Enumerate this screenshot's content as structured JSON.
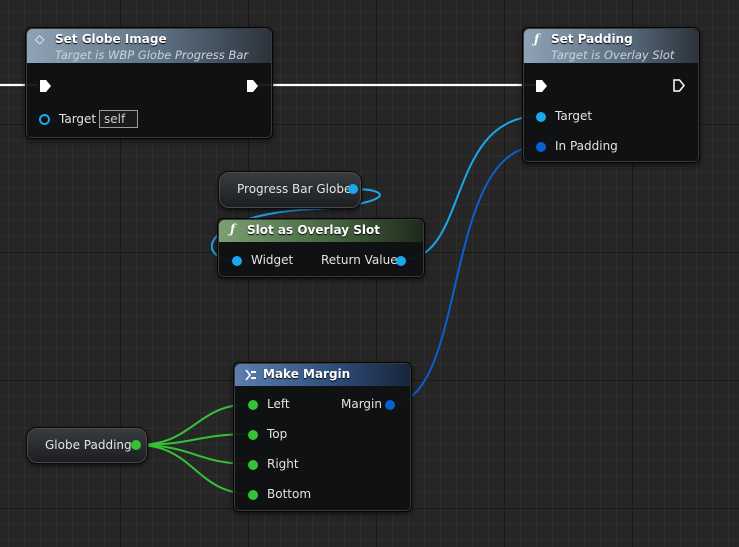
{
  "nodes": {
    "set_globe_image": {
      "title": "Set Globe Image",
      "subtitle": "Target is WBP Globe Progress Bar",
      "target_label": "Target",
      "target_value": "self"
    },
    "set_padding": {
      "title": "Set Padding",
      "subtitle": "Target is Overlay Slot",
      "target_label": "Target",
      "in_padding_label": "In Padding"
    },
    "progress_bar_globe": {
      "label": "Progress Bar Globe"
    },
    "slot_as_overlay_slot": {
      "title": "Slot as Overlay Slot",
      "widget_label": "Widget",
      "return_label": "Return Value"
    },
    "make_margin": {
      "title": "Make Margin",
      "left_label": "Left",
      "top_label": "Top",
      "right_label": "Right",
      "bottom_label": "Bottom",
      "margin_label": "Margin"
    },
    "globe_padding": {
      "label": "Globe Padding"
    }
  },
  "colors": {
    "exec_wire": "#ffffff",
    "object_pin": "#1aa7ec",
    "struct_pin": "#0a5fd1",
    "float_pin": "#35c235"
  }
}
